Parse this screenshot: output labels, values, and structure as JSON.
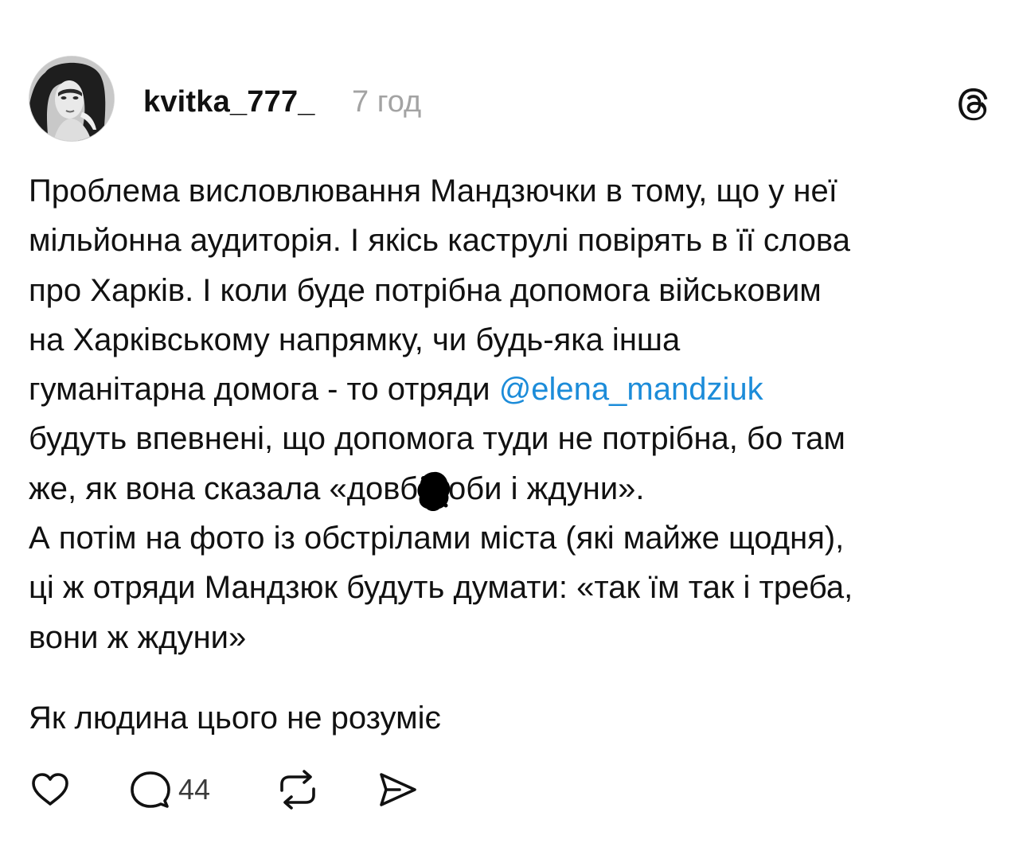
{
  "post": {
    "author": {
      "username": "kvitka_777_",
      "avatar_icon": "profile-photo"
    },
    "time": "7 год",
    "app_icon": "threads-logo-icon",
    "paragraphs": [
      {
        "lines": [
          "Проблема висловлювання Мандзючки в тому, що у неї",
          "мільйонна аудиторія. І якісь каструлі повірять в її слова",
          "про Харків. І коли буде потрібна допомога військовим",
          "на Харківському напрямку, чи будь-яка інша"
        ],
        "line5_prefix": "гуманітарна домога - то отряди ",
        "mention": "@elena_mandziuk",
        "line6": "будуть впевнені, що допомога туди не потрібна, бо там",
        "line7_before_blot": "же, як вона сказала «довб",
        "line7_after_blot": "оби і ждуни»."
      },
      {
        "lines": [
          "А потім на фото із обстрілами міста (які майже щодня),",
          "ці ж отряди Мандзюк будуть думати: «так їм так і треба,",
          "вони ж ждуни»"
        ]
      }
    ],
    "footer_text": "Як людина цього не розуміє",
    "actions": {
      "like_icon": "heart-icon",
      "reply_icon": "comment-bubble-icon",
      "reply_count": "44",
      "repost_icon": "repost-icon",
      "share_icon": "send-icon"
    },
    "colors": {
      "text": "#111111",
      "muted": "#a3a3a3",
      "mention": "#1c8cd9"
    }
  }
}
